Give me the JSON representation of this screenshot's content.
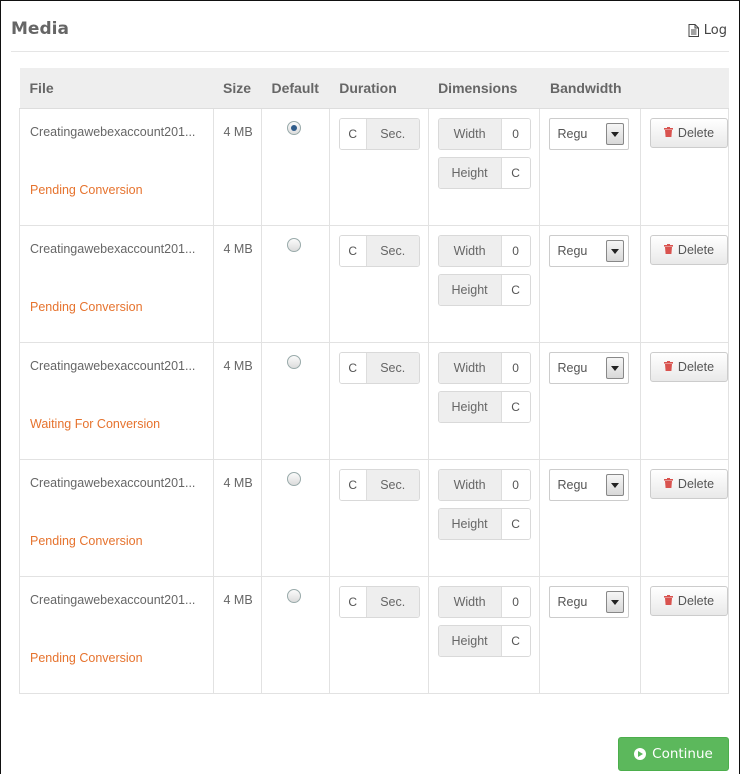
{
  "panel": {
    "title": "Media",
    "log_label": "Log"
  },
  "table": {
    "headers": [
      "File",
      "Size",
      "Default",
      "Duration",
      "Dimensions",
      "Bandwidth"
    ],
    "duration_unit": "Sec.",
    "width_label": "Width",
    "height_label": "Height",
    "delete_label": "Delete",
    "rows": [
      {
        "file": "Creatingawebexaccount201...",
        "size": "4 MB",
        "default": true,
        "duration": "C",
        "width": "0",
        "height": "C",
        "bandwidth": "Regu",
        "status": "Pending Conversion"
      },
      {
        "file": "Creatingawebexaccount201...",
        "size": "4 MB",
        "default": false,
        "duration": "C",
        "width": "0",
        "height": "C",
        "bandwidth": "Regu",
        "status": "Pending Conversion"
      },
      {
        "file": "Creatingawebexaccount201...",
        "size": "4 MB",
        "default": false,
        "duration": "C",
        "width": "0",
        "height": "C",
        "bandwidth": "Regu",
        "status": "Waiting For Conversion"
      },
      {
        "file": "Creatingawebexaccount201...",
        "size": "4 MB",
        "default": false,
        "duration": "C",
        "width": "0",
        "height": "C",
        "bandwidth": "Regu",
        "status": "Pending Conversion"
      },
      {
        "file": "Creatingawebexaccount201...",
        "size": "4 MB",
        "default": false,
        "duration": "C",
        "width": "0",
        "height": "C",
        "bandwidth": "Regu",
        "status": "Pending Conversion"
      }
    ]
  },
  "footer": {
    "continue_label": "Continue"
  },
  "colors": {
    "status": "#e6732e",
    "continue": "#5cb85c",
    "delete_icon": "#d9534f"
  },
  "icons": {
    "log": "file-text-icon",
    "delete": "trash-icon",
    "continue": "arrow-circle-right-icon"
  }
}
